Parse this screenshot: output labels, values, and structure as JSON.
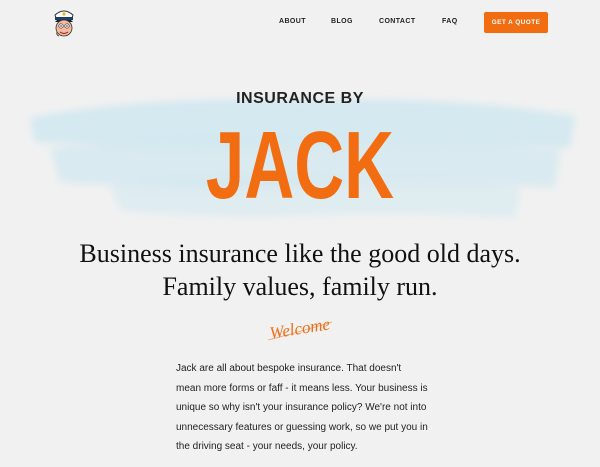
{
  "header": {
    "logo_icon": "captain-jack-avatar-icon",
    "nav": [
      {
        "label": "ABOUT"
      },
      {
        "label": "BLOG"
      },
      {
        "label": "CONTACT"
      },
      {
        "label": "FAQ"
      }
    ],
    "cta_label": "GET A QUOTE"
  },
  "hero": {
    "brand_prefix": "INSURANCE BY",
    "brand_name": "JACK",
    "headline_line1": "Business insurance like the good old days.",
    "headline_line2": "Family values, family run.",
    "welcome": "Welcome"
  },
  "intro": {
    "text": "Jack are all about bespoke insurance. That doesn't mean more forms or faff - it means less. Your business is unique so why isn't your insurance policy? We're not into unnecessary features or guessing work, so we put you in the driving seat - your needs, your policy."
  },
  "colors": {
    "accent": "#f26d12",
    "background": "#f1f1f1",
    "wash": "#cfe7f0"
  }
}
